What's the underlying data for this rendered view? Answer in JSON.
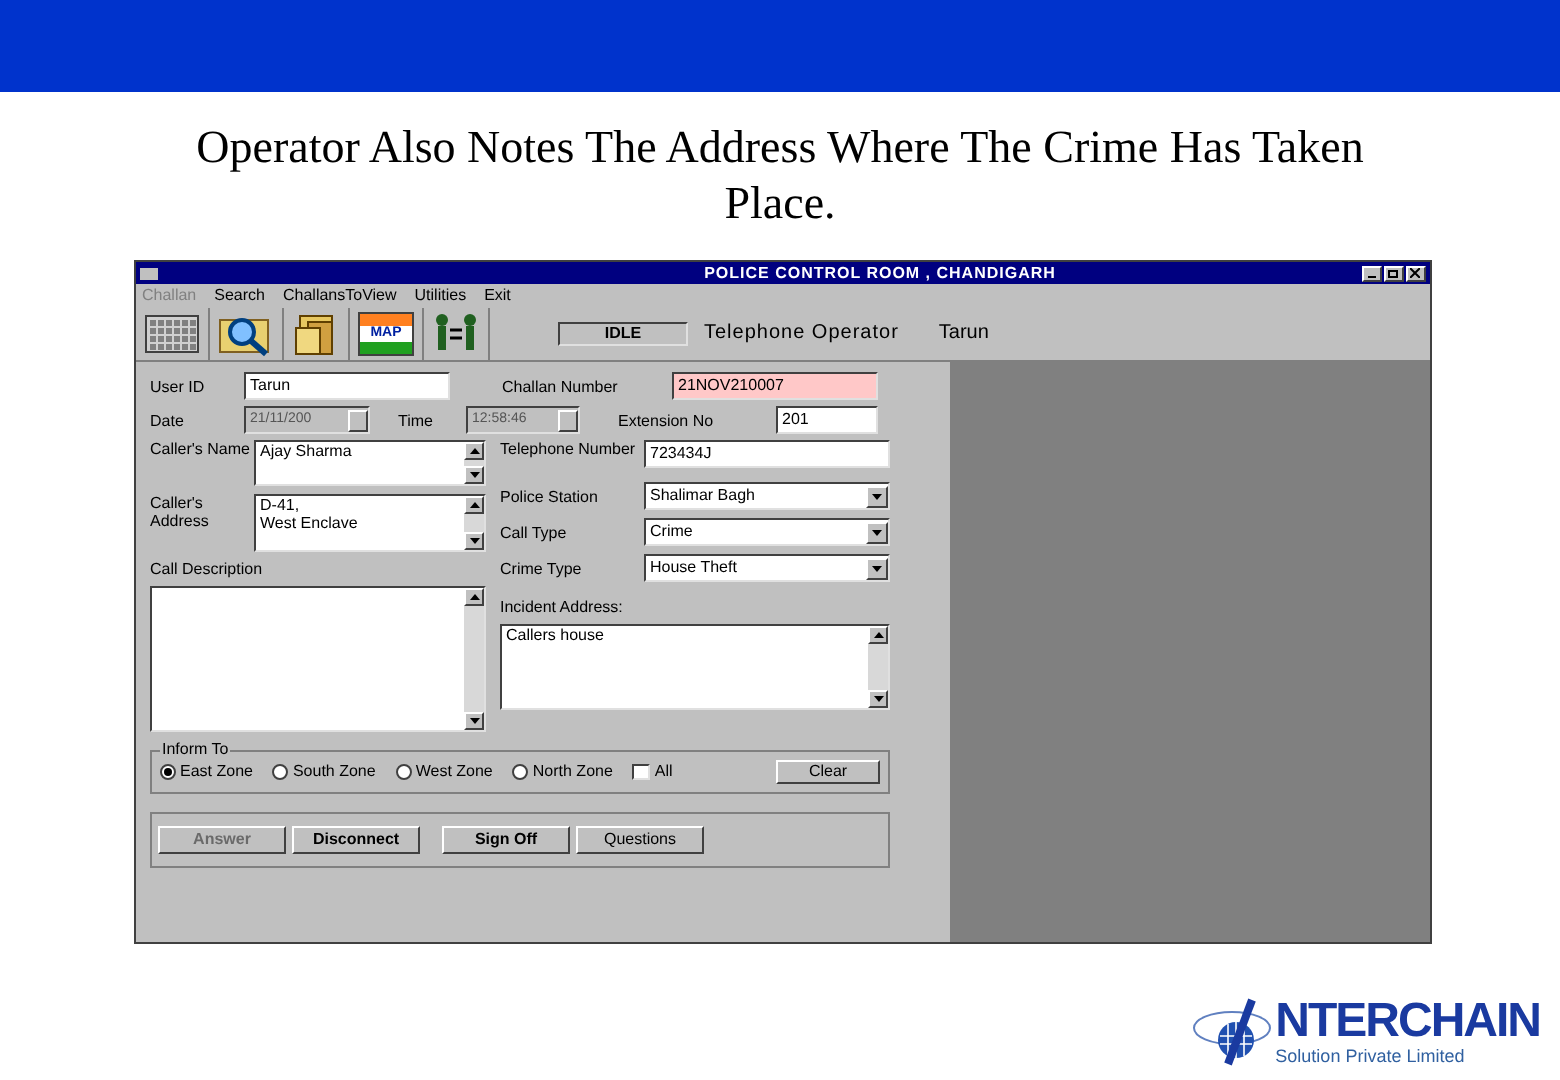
{
  "slide": {
    "title": "Operator Also Notes The Address Where The Crime Has Taken Place.",
    "logo": "NTERCHAIN",
    "logo_tagline": "Solution Private Limited"
  },
  "window": {
    "title": "POLICE CONTROL ROOM , CHANDIGARH"
  },
  "menu": [
    {
      "label": "Challan",
      "disabled": true
    },
    {
      "label": "Search",
      "disabled": false
    },
    {
      "label": "ChallansToView",
      "disabled": false
    },
    {
      "label": "Utilities",
      "disabled": false
    },
    {
      "label": "Exit",
      "disabled": false
    }
  ],
  "toolbar": {
    "buttons": [
      {
        "kind": "keyboard"
      },
      {
        "kind": "search"
      },
      {
        "kind": "files"
      },
      {
        "kind": "map",
        "label": "MAP"
      },
      {
        "kind": "transfer"
      }
    ],
    "status": "IDLE",
    "role": "Telephone Operator",
    "user": "Tarun"
  },
  "form": {
    "user_id": {
      "label": "User ID",
      "value": "Tarun"
    },
    "challan_number": {
      "label": "Challan Number",
      "value": "21NOV210007"
    },
    "date": {
      "label": "Date",
      "value": "21/11/200",
      "disabled": true
    },
    "time": {
      "label": "Time",
      "value": "12:58:46",
      "disabled": true
    },
    "extension": {
      "label": "Extension No",
      "value": "201"
    },
    "caller_name": {
      "label": "Caller's Name",
      "value": "Ajay Sharma"
    },
    "caller_address": {
      "label": "Caller's Address",
      "value": "D-41,\nWest Enclave"
    },
    "call_description": {
      "label": "Call Description"
    },
    "telephone": {
      "label": "Telephone Number",
      "value": "723434J"
    },
    "police_station": {
      "label": "Police Station",
      "value": "Shalimar Bagh"
    },
    "call_type": {
      "label": "Call Type",
      "value": "Crime"
    },
    "crime_type": {
      "label": "Crime Type",
      "value": "House Theft"
    },
    "incident_address": {
      "label": "Incident Address:",
      "value": "Callers house"
    }
  },
  "inform_to": {
    "label": "Inform To",
    "zones": [
      {
        "label": "East Zone",
        "selected": true
      },
      {
        "label": "South Zone",
        "selected": false
      },
      {
        "label": "West Zone",
        "selected": false
      },
      {
        "label": "North Zone",
        "selected": false
      }
    ],
    "all": {
      "label": "All",
      "checked": false
    },
    "clear": "Clear"
  },
  "actions": [
    {
      "label": "Answer",
      "disabled": true,
      "bold": true
    },
    {
      "label": "Disconnect",
      "disabled": false,
      "bold": true
    },
    {
      "label": "Sign Off",
      "disabled": false,
      "bold": true
    },
    {
      "label": "Questions",
      "disabled": false,
      "bold": false
    }
  ]
}
